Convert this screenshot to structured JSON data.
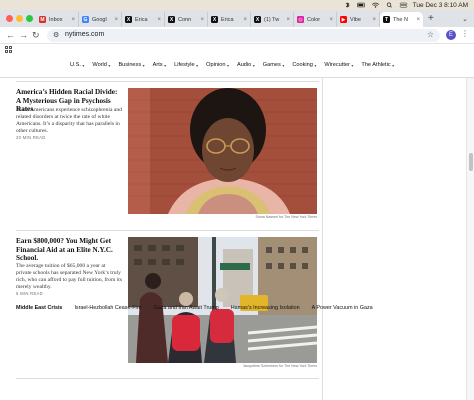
{
  "menubar": {
    "datetime": "Tue Dec 3  8:10 AM"
  },
  "browser": {
    "tabs": [
      {
        "label": "Inbox",
        "icon": "gmail-icon",
        "color": "#d93025",
        "glyph": "M",
        "active": false
      },
      {
        "label": "Googl",
        "icon": "google-docs-icon",
        "color": "#4285f4",
        "glyph": "G",
        "active": false
      },
      {
        "label": "Erica",
        "icon": "x-icon",
        "color": "#111111",
        "glyph": "X",
        "active": false
      },
      {
        "label": "Conn",
        "icon": "x-icon",
        "color": "#111111",
        "glyph": "X",
        "active": false
      },
      {
        "label": "Erica",
        "icon": "x-icon",
        "color": "#111111",
        "glyph": "X",
        "active": false
      },
      {
        "label": "(1) Tw",
        "icon": "x-icon",
        "color": "#111111",
        "glyph": "X",
        "active": false
      },
      {
        "label": "Color",
        "icon": "instagram-icon",
        "color": "#d6249f",
        "glyph": "◎",
        "active": false
      },
      {
        "label": "Vibe",
        "icon": "youtube-icon",
        "color": "#ff0000",
        "glyph": "▶",
        "active": false
      },
      {
        "label": "The N",
        "icon": "nyt-icon",
        "color": "#111111",
        "glyph": "T",
        "active": true
      }
    ],
    "new_tab_symbol": "+",
    "url": "nytimes.com",
    "profile_initial": "E",
    "colors": {
      "tabstrip": "#dfe3e8",
      "omnibox": "#eef1f6",
      "profile": "#5b4fcf"
    }
  },
  "nyt_nav": {
    "items": [
      "U.S.",
      "World",
      "Business",
      "Arts",
      "Lifestyle",
      "Opinion",
      "Audio",
      "Games",
      "Cooking",
      "Wirecutter",
      "The Athletic"
    ]
  },
  "stories": [
    {
      "title": "America’s Hidden Racial Divide: A Mysterious Gap in Psychosis Rates",
      "summary": "Black Americans experience schizophrenia and related disorders at twice the rate of white Americans. It’s a disparity that has parallels in other cultures.",
      "read_time": "20 MIN READ",
      "photo_credit": "Sinna Nasseri for The New York Times"
    },
    {
      "title": "Earn $800,000? You Might Get Financial Aid at an Elite N.Y.C. School.",
      "summary": "The average tuition of $65,000 a year at private schools has separated New York’s truly rich, who can afford to pay full tuition, from its merely wealthy.",
      "read_time": "5 MIN READ",
      "photo_credit": "Jacqueline Schenkers for The New York Times"
    }
  ],
  "trending": {
    "heading": "Middle East Crisis",
    "links": [
      "Israel-Hezbollah Cease-Fire",
      "Gaza and Iran Await Trump",
      "Hamas’s Increasing Isolation",
      "A Power Vacuum in Gaza"
    ]
  }
}
